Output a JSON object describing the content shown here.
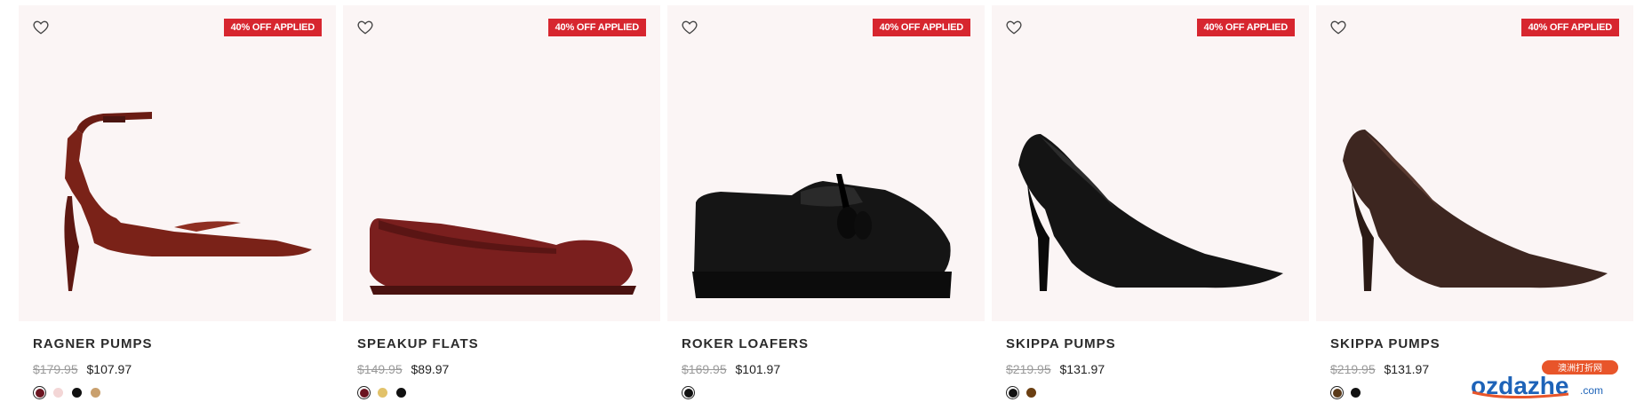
{
  "products": [
    {
      "badge": "40% OFF APPLIED",
      "name": "RAGNER PUMPS",
      "original_price": "$179.95",
      "sale_price": "$107.97",
      "colors": [
        "#6b1420",
        "#f3d6d6",
        "#111111",
        "#c9a06e"
      ],
      "selected_color": 0,
      "image": "burgundy-croc-ankle-strap-pump"
    },
    {
      "badge": "40% OFF APPLIED",
      "name": "SPEAKUP FLATS",
      "original_price": "$149.95",
      "sale_price": "$89.97",
      "colors": [
        "#6b1420",
        "#e2c26a",
        "#111111"
      ],
      "selected_color": 0,
      "image": "burgundy-pointed-flat"
    },
    {
      "badge": "40% OFF APPLIED",
      "name": "ROKER LOAFERS",
      "original_price": "$169.95",
      "sale_price": "$101.97",
      "colors": [
        "#111111"
      ],
      "selected_color": 0,
      "image": "black-tassel-loafer"
    },
    {
      "badge": "40% OFF APPLIED",
      "name": "SKIPPA PUMPS",
      "original_price": "$219.95",
      "sale_price": "$131.97",
      "colors": [
        "#111111",
        "#6b3f12"
      ],
      "selected_color": 0,
      "image": "black-pointed-pump"
    },
    {
      "badge": "40% OFF APPLIED",
      "name": "SKIPPA PUMPS",
      "original_price": "$219.95",
      "sale_price": "$131.97",
      "colors": [
        "#5a3a1a",
        "#111111"
      ],
      "selected_color": 0,
      "image": "brown-pointed-pump"
    }
  ],
  "watermark": {
    "brand": "ozdazhe",
    "suffix": ".com",
    "tag": "澳洲打折网"
  }
}
